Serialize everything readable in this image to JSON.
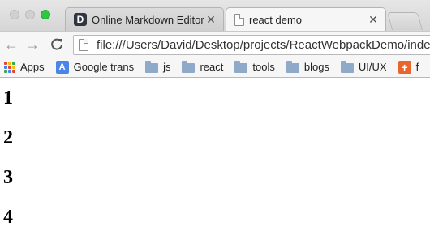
{
  "window": {
    "traffic_lights": {
      "close_color": "#d0d0d0",
      "minimize_color": "#d0d0d0",
      "maximize_color": "#2bc840"
    }
  },
  "tabs": [
    {
      "label": "Online Markdown Editor - I",
      "icon": "d-logo-icon",
      "close": "✕",
      "active": false
    },
    {
      "label": "react demo",
      "icon": "page-icon",
      "close": "✕",
      "active": true
    }
  ],
  "toolbar": {
    "back": "←",
    "forward": "→",
    "reload": "C",
    "url": "file:///Users/David/Desktop/projects/ReactWebpackDemo/index"
  },
  "bookmarks": [
    {
      "label": "Apps",
      "icon": "apps-grid-icon"
    },
    {
      "label": "Google trans",
      "icon": "translate-icon"
    },
    {
      "label": "js",
      "icon": "folder-icon"
    },
    {
      "label": "react",
      "icon": "folder-icon"
    },
    {
      "label": "tools",
      "icon": "folder-icon"
    },
    {
      "label": "blogs",
      "icon": "folder-icon"
    },
    {
      "label": "UI/UX",
      "icon": "folder-icon"
    },
    {
      "label": "f",
      "icon": "plus-icon"
    }
  ],
  "content": {
    "headings": [
      "1",
      "2",
      "3",
      "4"
    ]
  },
  "colors": {
    "apps_grid": [
      "#e94335",
      "#fbbc05",
      "#34a853",
      "#4285f4",
      "#e94335",
      "#fbbc05",
      "#34a853",
      "#4285f4",
      "#e94335"
    ]
  }
}
